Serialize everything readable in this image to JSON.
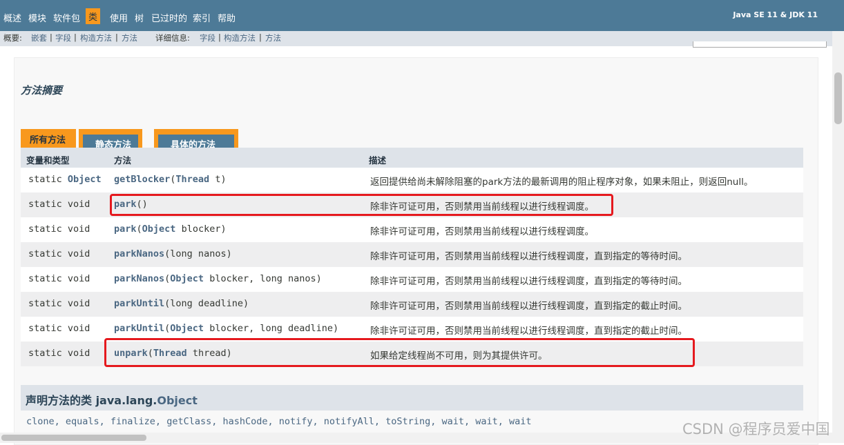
{
  "topnav": {
    "items": [
      "概述",
      "模块",
      "软件包",
      "类",
      "使用",
      "树",
      "已过时的",
      "索引",
      "帮助"
    ],
    "active_index": 3,
    "about": "Java SE 11 & JDK 11"
  },
  "subnav": {
    "summary_label": "概要:",
    "summary_links": [
      "嵌套",
      "字段",
      "构造方法",
      "方法"
    ],
    "detail_label": "详细信息:",
    "detail_links": [
      "字段",
      "构造方法",
      "方法"
    ]
  },
  "section_title": "方法摘要",
  "tabs": [
    "所有方法",
    "静态方法",
    "具体的方法"
  ],
  "table": {
    "headers": [
      "变量和类型",
      "方法",
      "描述"
    ],
    "rows": [
      {
        "type": "static",
        "rtype": "Object",
        "name": "getBlocker",
        "params": [
          [
            "Thread",
            " t"
          ]
        ],
        "desc": "返回提供给尚未解除阻塞的park方法的最新调用的阻止程序对象，如果未阻止，则返回null。",
        "highlighted": false
      },
      {
        "type": "static",
        "rtype": "void",
        "name": "park",
        "params": [],
        "desc": "除非许可证可用，否则禁用当前线程以进行线程调度。",
        "highlighted": true
      },
      {
        "type": "static",
        "rtype": "void",
        "name": "park",
        "params": [
          [
            "Object",
            " blocker"
          ]
        ],
        "desc": "除非许可证可用，否则禁用当前线程以进行线程调度。",
        "highlighted": false
      },
      {
        "type": "static",
        "rtype": "void",
        "name": "parkNanos",
        "params": [
          [
            "",
            "long nanos"
          ]
        ],
        "desc": "除非许可证可用，否则禁用当前线程以进行线程调度，直到指定的等待时间。",
        "highlighted": false
      },
      {
        "type": "static",
        "rtype": "void",
        "name": "parkNanos",
        "params": [
          [
            "Object",
            " blocker"
          ],
          [
            "",
            "long nanos"
          ]
        ],
        "desc": "除非许可证可用，否则禁用当前线程以进行线程调度，直到指定的等待时间。",
        "highlighted": false
      },
      {
        "type": "static",
        "rtype": "void",
        "name": "parkUntil",
        "params": [
          [
            "",
            "long deadline"
          ]
        ],
        "desc": "除非许可证可用，否则禁用当前线程以进行线程调度，直到指定的截止时间。",
        "highlighted": false
      },
      {
        "type": "static",
        "rtype": "void",
        "name": "parkUntil",
        "params": [
          [
            "Object",
            " blocker"
          ],
          [
            "",
            "long deadline"
          ]
        ],
        "desc": "除非许可证可用，否则禁用当前线程以进行线程调度，直到指定的截止时间。",
        "highlighted": false
      },
      {
        "type": "static",
        "rtype": "void",
        "name": "unpark",
        "params": [
          [
            "Thread",
            " thread"
          ]
        ],
        "desc": "如果给定线程尚不可用，则为其提供许可。",
        "highlighted": true
      }
    ]
  },
  "inherited": {
    "prefix": "声明方法的类 java.lang.",
    "link": "Object",
    "methods": "clone, equals, finalize, getClass, hashCode, notify, notifyAll, toString, wait, wait, wait"
  },
  "watermark": "CSDN @程序员爱中国",
  "colors": {
    "nav": "#4d7a97",
    "active_tab": "#f8981d",
    "highlight_box": "#e5191e"
  }
}
